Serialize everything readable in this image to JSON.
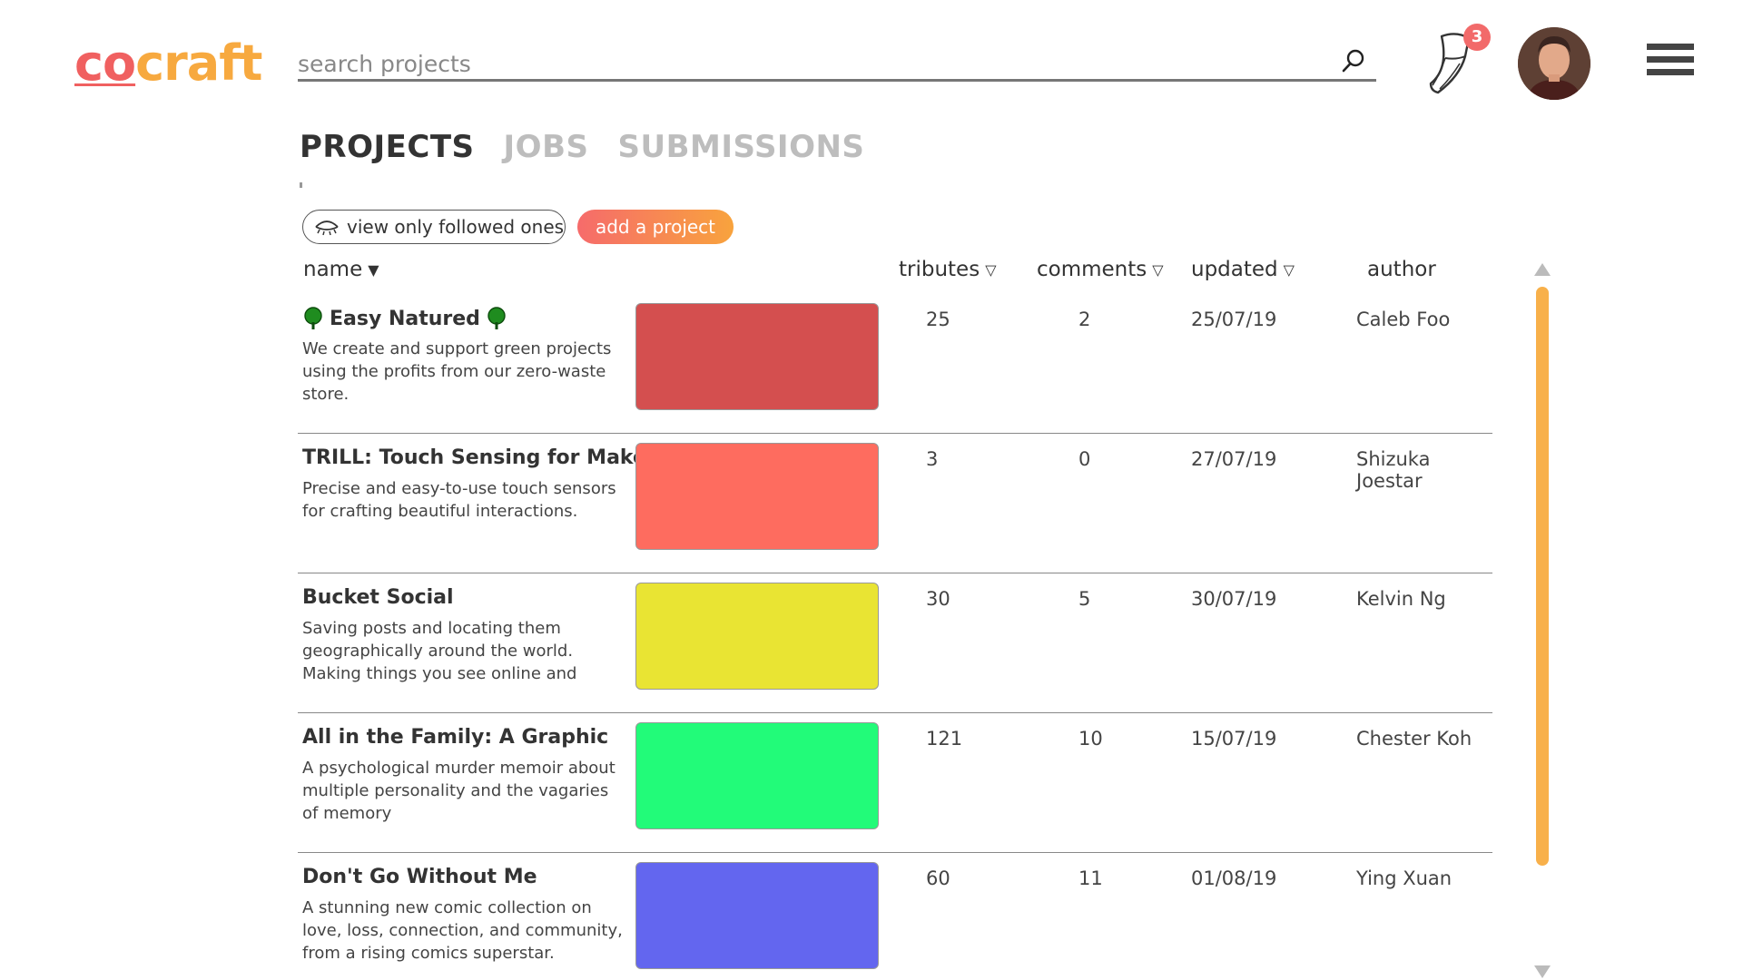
{
  "brand": {
    "logo_part1": "co",
    "logo_part2": "craft"
  },
  "search": {
    "placeholder": "search projects",
    "value": ""
  },
  "notifications": {
    "count": "3"
  },
  "tabs": [
    {
      "label": "PROJECTS",
      "active": true
    },
    {
      "label": "JOBS",
      "active": false
    },
    {
      "label": "SUBMISSIONS",
      "active": false
    }
  ],
  "filter": {
    "follow_label": "view only followed ones",
    "add_label": "add a project"
  },
  "columns": {
    "name": "name",
    "tributes": "tributes",
    "comments": "comments",
    "updated": "updated",
    "author": "author"
  },
  "projects": [
    {
      "title": "Easy Natured",
      "description": "We create and support green projects using the profits from our zero-waste store.",
      "color": "#d44f4f",
      "tributes": "25",
      "comments": "2",
      "updated": "25/07/19",
      "author": "Caleb Foo",
      "tree_icons": true
    },
    {
      "title": "TRILL: Touch Sensing for Makers",
      "description": "Precise and easy-to-use touch sensors for crafting beautiful interactions.",
      "color": "#fe6c5f",
      "tributes": "3",
      "comments": "0",
      "updated": "27/07/19",
      "author": "Shizuka Joestar",
      "tree_icons": false
    },
    {
      "title": "Bucket Social",
      "description": "Saving posts and locating them geographically around the world. Making things you see online and",
      "color": "#e9e433",
      "tributes": "30",
      "comments": "5",
      "updated": "30/07/19",
      "author": "Kelvin Ng",
      "tree_icons": false
    },
    {
      "title": "All in the Family: A Graphic",
      "description": "A psychological murder memoir about multiple personality and the vagaries of memory",
      "color": "#22fb79",
      "tributes": "121",
      "comments": "10",
      "updated": "15/07/19",
      "author": "Chester Koh",
      "tree_icons": false
    },
    {
      "title": "Don't Go Without Me",
      "description": "A stunning new comic collection on love, loss, connection, and community, from a rising comics superstar.",
      "color": "#6366ef",
      "tributes": "60",
      "comments": "11",
      "updated": "01/08/19",
      "author": "Ying Xuan",
      "tree_icons": false
    }
  ],
  "colors": {
    "logo_red": "#f06060",
    "logo_orange": "#f7a93f",
    "scrollbar": "#f8b04a",
    "badge": "#f26a6a"
  }
}
